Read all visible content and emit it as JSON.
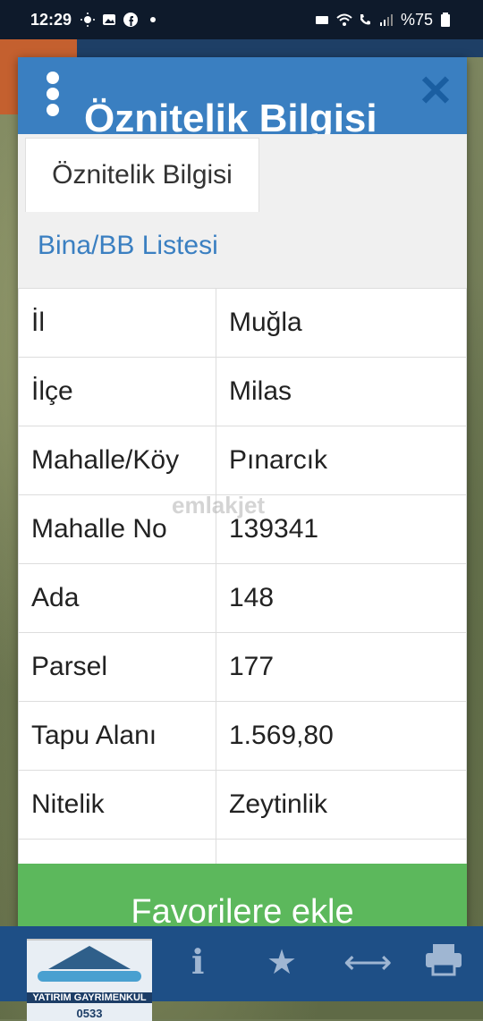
{
  "statusbar": {
    "time": "12:29",
    "battery": "%75",
    "icons_left": [
      "sun-icon",
      "gallery-icon",
      "facebook-icon",
      "dot-icon"
    ],
    "icons_right": [
      "cast-icon",
      "wifi-icon",
      "call-icon",
      "signal-icon",
      "battery-icon"
    ]
  },
  "dialog": {
    "title": "Öznitelik Bilgisi",
    "tabs": [
      {
        "label": "Öznitelik Bilgisi",
        "active": true
      },
      {
        "label": "Bina/BB Listesi",
        "active": false
      }
    ],
    "rows": [
      {
        "key": "İl",
        "value": "Muğla"
      },
      {
        "key": "İlçe",
        "value": "Milas"
      },
      {
        "key": "Mahalle/Köy",
        "value": "Pınarcık"
      },
      {
        "key": "Mahalle No",
        "value": "139341"
      },
      {
        "key": "Ada",
        "value": "148"
      },
      {
        "key": "Parsel",
        "value": "177"
      },
      {
        "key": "Tapu Alanı",
        "value": "1.569,80"
      },
      {
        "key": "Nitelik",
        "value": "Zeytinlik"
      },
      {
        "key": "",
        "value": ""
      }
    ],
    "favorite_button": "Favorilere ekle",
    "watermark": "emlakjet"
  },
  "logo": {
    "name": "YATIRIM GAYRİMENKUL",
    "phone": "0533"
  },
  "colors": {
    "header_blue": "#3a7fc1",
    "button_green": "#5cb85c",
    "toolbar_blue": "#1e4f86"
  }
}
